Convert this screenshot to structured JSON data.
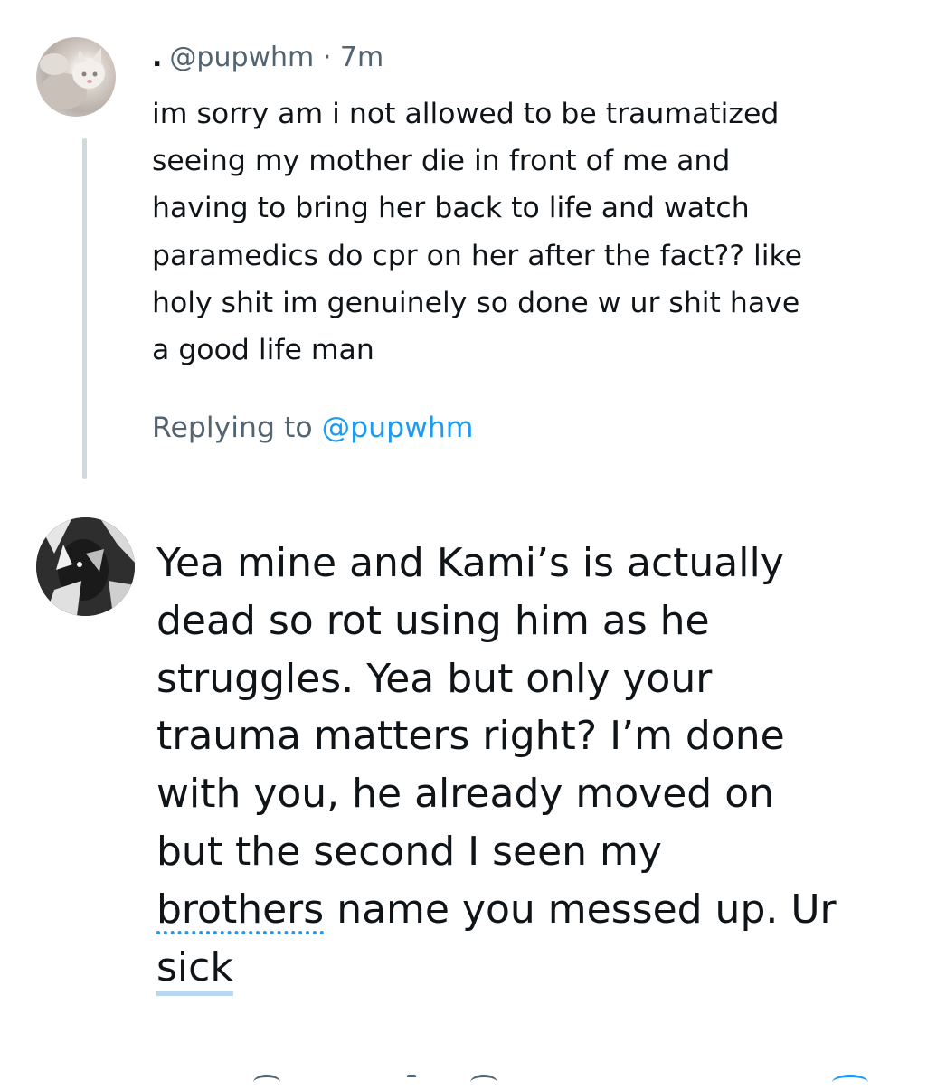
{
  "parent_tweet": {
    "name_marker": ".",
    "handle": "@pupwhm",
    "separator": "·",
    "time": "7m",
    "lines": [
      "im sorry am i not allowed to be traumatized",
      "seeing my mother die in front of me and",
      "having to bring her back to life and watch",
      "paramedics do cpr on her after the fact?? like",
      "holy shit im genuinely so done w ur shit have",
      "a good life man"
    ],
    "avatar_icon": "cat-avatar"
  },
  "reply_context": {
    "prefix": "Replying to ",
    "mention": "@pupwhm"
  },
  "reply_tweet": {
    "avatar_icon": "dark-animal-avatar",
    "lines": [
      "Yea mine and Kami’s is actually",
      "dead so rot using him as he",
      "struggles. Yea but only your",
      "trauma matters right? I’m done",
      "with you, he already moved on",
      "but the second I seen my"
    ],
    "line7_word": "brothers",
    "line7_rest": " name you messed up. Ur",
    "line8_word": "sick"
  },
  "colors": {
    "text": "#0f1419",
    "secondary": "#536471",
    "link": "#1d9bf0",
    "thread_line": "#cfd9de"
  },
  "icons": [
    "reply-icon",
    "retweet-icon",
    "like-icon",
    "share-icon"
  ]
}
